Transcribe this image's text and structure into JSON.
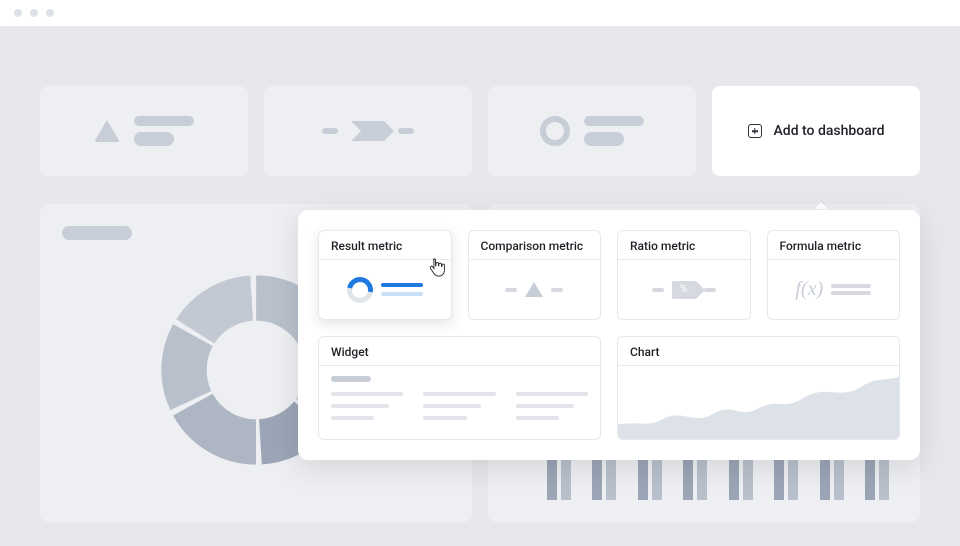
{
  "action_button": {
    "label": "Add to dashboard"
  },
  "popover": {
    "metrics": [
      {
        "label": "Result metric"
      },
      {
        "label": "Comparison metric"
      },
      {
        "label": "Ratio metric"
      },
      {
        "label": "Formula metric"
      }
    ],
    "widgets": [
      {
        "label": "Widget"
      },
      {
        "label": "Chart"
      }
    ],
    "ratio_symbol": "%",
    "formula_symbol": "f(x)"
  },
  "dashboard": {
    "donut": {
      "segments": [
        {
          "value": 20,
          "color": "#B8C0CC"
        },
        {
          "value": 16,
          "color": "#C8CED7"
        },
        {
          "value": 14,
          "color": "#9BA5B5"
        },
        {
          "value": 18,
          "color": "#AEB6C3"
        },
        {
          "value": 16,
          "color": "#B8C0CC"
        },
        {
          "value": 16,
          "color": "#C3C9D3"
        }
      ]
    },
    "bars": [
      [
        40,
        55
      ],
      [
        30,
        42
      ],
      [
        52,
        38
      ],
      [
        48,
        60
      ],
      [
        35,
        50
      ],
      [
        44,
        32
      ],
      [
        56,
        46
      ],
      [
        38,
        52
      ]
    ]
  }
}
